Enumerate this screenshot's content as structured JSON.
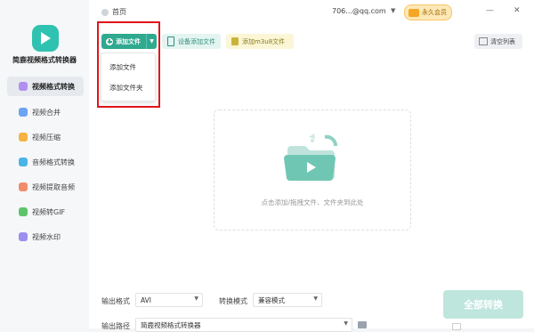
{
  "app": {
    "title": "简鹿视频格式转换器"
  },
  "sidebar": {
    "items": [
      {
        "label": "视频格式转换",
        "color": "#b28ef0"
      },
      {
        "label": "视频合并",
        "color": "#6ba4f2"
      },
      {
        "label": "视频压缩",
        "color": "#f5b342"
      },
      {
        "label": "音频格式转换",
        "color": "#4ab3e8"
      },
      {
        "label": "视频提取音频",
        "color": "#f28d6b"
      },
      {
        "label": "视频转GIF",
        "color": "#5dc46b"
      },
      {
        "label": "视频水印",
        "color": "#9b8ef0"
      }
    ]
  },
  "header": {
    "breadcrumb": "首页",
    "account": "706...@qq.com",
    "vip_label": "永久会员",
    "minimize": "—",
    "close": "✕"
  },
  "toolbar": {
    "add_file": "添加文件",
    "device_add": "设备添加文件",
    "add_m3u8": "添加m3u8文件",
    "clear_list": "清空列表"
  },
  "dropdown": {
    "items": [
      "添加文件",
      "添加文件夹"
    ]
  },
  "dropzone": {
    "text": "点击添加/拖拽文件、文件夹到此处"
  },
  "settings": {
    "output_format_label": "输出格式",
    "output_format_value": "AVI",
    "convert_mode_label": "转换模式",
    "convert_mode_value": "兼容模式",
    "output_path_label": "输出路径",
    "output_path_value": "简鹿视频格式转换器"
  },
  "actions": {
    "convert_all": "全部转换"
  },
  "colors": {
    "accent": "#2fa98f",
    "highlight_box": "#e0141a",
    "vip": "#f5a623"
  }
}
